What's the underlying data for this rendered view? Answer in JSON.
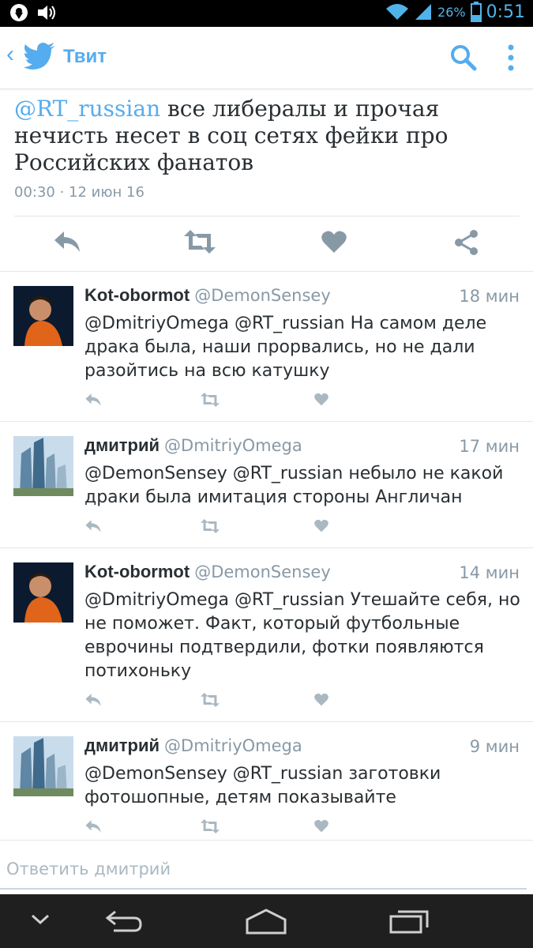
{
  "status_bar": {
    "battery": "26%",
    "time": "0:51"
  },
  "header": {
    "back": "‹",
    "title": "Твит"
  },
  "main_tweet": {
    "mention": "@RT_russian",
    "text": " все либералы и прочая нечисть несет в соц сетях фейки про Российских фанатов",
    "timestamp": "00:30 · 12 июн 16"
  },
  "replies": [
    {
      "name": "Kot-obormot",
      "handle": "@DemonSensey",
      "time": "18 мин",
      "text": "@DmitriyOmega @RT_russian На самом деле драка была, наши прорвались, но не дали разойтись на всю катушку"
    },
    {
      "name": "дмитрий",
      "handle": "@DmitriyOmega",
      "time": "17 мин",
      "text": "@DemonSensey @RT_russian небыло не какой драки была имитация стороны Англичан"
    },
    {
      "name": "Kot-obormot",
      "handle": "@DemonSensey",
      "time": "14 мин",
      "text": "@DmitriyOmega @RT_russian Утешайте себя, но не поможет. Факт, который футбольные еврочины подтвердили, фотки появляются потихоньку"
    },
    {
      "name": "дмитрий",
      "handle": "@DmitriyOmega",
      "time": "9 мин",
      "text": "@DemonSensey @RT_russian заготовки фотошопные, детям показывайте"
    }
  ],
  "reply_box": {
    "placeholder": "Ответить дмитрий"
  },
  "colors": {
    "accent": "#55acee",
    "icon_gray": "#aab8c2",
    "action_gray": "#8899a6"
  }
}
